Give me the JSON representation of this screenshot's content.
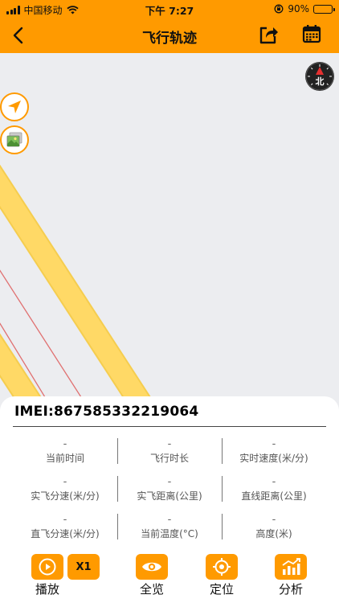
{
  "status_bar": {
    "carrier": "中国移动",
    "time": "下午 7:27",
    "battery": "90%",
    "battery_level": 0.9
  },
  "nav": {
    "title": "飞行轨迹"
  },
  "map": {
    "compass_label": "北"
  },
  "panel": {
    "imei": "IMEI:867585332219064",
    "stats": [
      [
        {
          "value": "-",
          "label": "当前时间"
        },
        {
          "value": "-",
          "label": "飞行时长"
        },
        {
          "value": "-",
          "label": "实时速度(米/分)"
        }
      ],
      [
        {
          "value": "-",
          "label": "实飞分速(米/分)"
        },
        {
          "value": "-",
          "label": "实飞距离(公里)"
        },
        {
          "value": "-",
          "label": "直线距离(公里)"
        }
      ],
      [
        {
          "value": "-",
          "label": "直飞分速(米/分)"
        },
        {
          "value": "-",
          "label": "当前温度(°C)"
        },
        {
          "value": "-",
          "label": "高度(米)"
        }
      ]
    ]
  },
  "actions": {
    "play": "播放",
    "speed": "X1",
    "overview": "全览",
    "locate": "定位",
    "analyze": "分析"
  },
  "colors": {
    "accent": "#FF9A00",
    "map_bg": "#ECEDF0",
    "road": "#FFD966",
    "track": "#E07070"
  }
}
